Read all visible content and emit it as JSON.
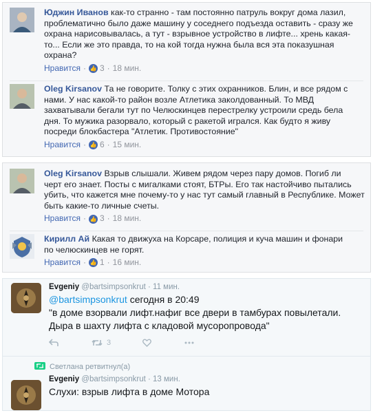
{
  "facebook_threads": [
    {
      "comments": [
        {
          "author": "Юджин Иванов",
          "text_lines": [
            "как-то странно - там постоянно патруль вокруг дома лазил,",
            "проблематично было даже машину у соседнего подъезда оставить - сразу же",
            "охрана нарисовывалась, а тут - взрывное устройство в лифте... хрень какая-",
            "то... Если же это правда, то на кой тогда нужна была вся эта показушная",
            "охрана?"
          ],
          "like_label": "Нравится",
          "likes": "3",
          "time": "18 мин."
        },
        {
          "author": "Oleg Kirsanov",
          "text_lines": [
            "Та не говорите. Толку с этих охранников. Блин, и все рядом с",
            "нами. У нас какой-то район возле Атлетика заколдованный. То МВД",
            "захватывали бегали тут по Челюскинцев перестрелку устроили средь бела",
            "дня. То мужика разорвало, который с ракетой игрался. Как будто я живу",
            "посреди блокбастера \"Атлетик. Противостояние\""
          ],
          "like_label": "Нравится",
          "likes": "6",
          "time": "15 мин."
        }
      ]
    },
    {
      "comments": [
        {
          "author": "Oleg Kirsanov",
          "text_lines": [
            "Взрыв слышали. Живем рядом через пару домов. Погиб ли",
            "черт его знает. Посты с мигалками стоят, БТРы. Его так настойчиво пытались",
            "убить, что кажется мне почему-то у нас тут самый главный в Республике. Может",
            "быть какие-то личные счеты."
          ],
          "like_label": "Нравится",
          "likes": "3",
          "time": "18 мин."
        },
        {
          "author": "Кирилл Ай",
          "text_lines": [
            "Какая то движуха на Корсаре, полиция и куча машин и фонари",
            "по челюскинцев не горят."
          ],
          "like_label": "Нравится",
          "likes": "1",
          "time": "16 мин."
        }
      ]
    }
  ],
  "twitter": {
    "tweets": [
      {
        "name": "Evgeniy",
        "handle": "@bartsimpsonkrut",
        "time": "11 мин.",
        "mention": "@bartsimpsonkrut",
        "stamp": "сегодня в 20:49",
        "quote_lines": [
          "\"в  доме взорвали лифт.нафиг все двери в тамбурах повылетали.",
          "Дыра в шахту лифта с кладовой мусоропровода\""
        ],
        "retweets": "3"
      },
      {
        "retweet_by": "Светлана ретвитнул(а)",
        "name": "Evgeniy",
        "handle": "@bartsimpsonkrut",
        "time": "13 мин.",
        "text": "Слухи: взрыв лифта в доме Мотора"
      }
    ]
  }
}
